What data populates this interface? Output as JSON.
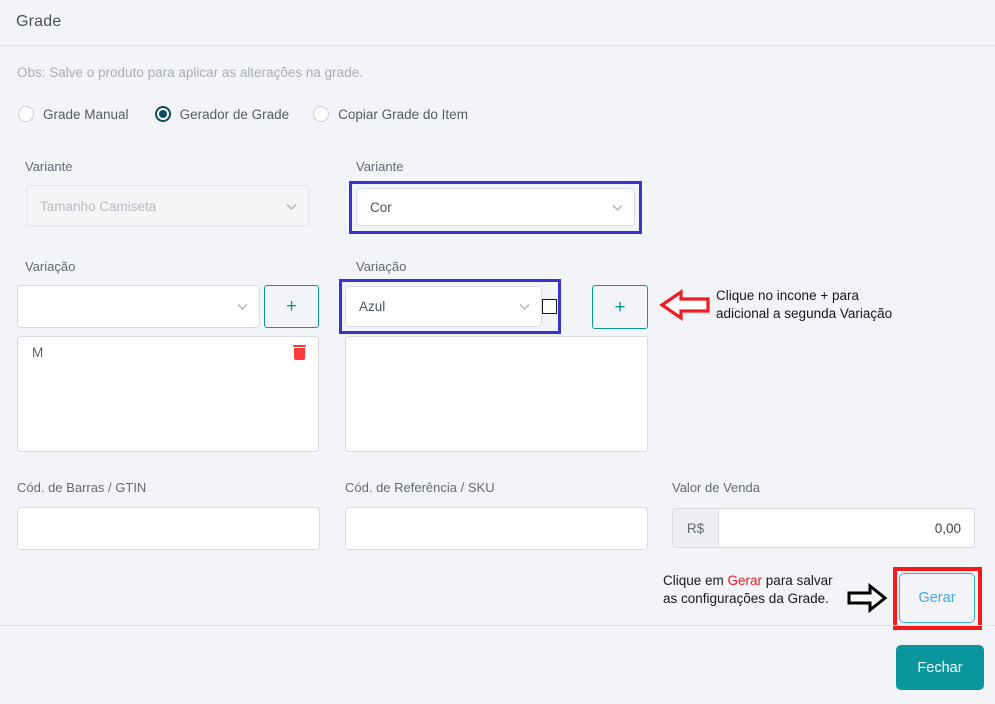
{
  "header": {
    "title": "Grade"
  },
  "body": {
    "obs": "Obs: Salve o produto para aplicar as alterações na grade.",
    "radios": [
      {
        "label": "Grade Manual",
        "selected": false
      },
      {
        "label": "Gerador de Grade",
        "selected": true
      },
      {
        "label": "Copiar Grade do Item",
        "selected": false
      }
    ],
    "variant_left": {
      "label": "Variante",
      "value": "Tamanho Camiseta",
      "disabled": true
    },
    "variant_right": {
      "label": "Variante",
      "value": "Cor",
      "highlighted": true
    },
    "variacao_left": {
      "label": "Variação",
      "value": "",
      "add_button": "+",
      "items": [
        {
          "label": "M",
          "delete_icon": "trash-icon"
        }
      ]
    },
    "variacao_right": {
      "label": "Variação",
      "value": "Azul",
      "checkbox_checked": false,
      "add_button": "+",
      "items": []
    },
    "barcode": {
      "label": "Cód. de Barras / GTIN",
      "value": ""
    },
    "sku": {
      "label": "Cód. de Referência / SKU",
      "value": ""
    },
    "price": {
      "label": "Valor de Venda",
      "prefix": "R$",
      "value": "0,00"
    }
  },
  "annotations": {
    "plus_hint_line1": "Clique no incone + para",
    "plus_hint_line2": "adicional a segunda Variação",
    "gerar_hint_prefix": "Clique em ",
    "gerar_hint_word": "Gerar",
    "gerar_hint_suffix": " para salvar",
    "gerar_hint_line2": "as configurações da Grade.",
    "arrow_left": "arrow-left-red",
    "arrow_right": "arrow-right-black"
  },
  "buttons": {
    "gerar": "Gerar",
    "fechar": "Fechar"
  },
  "colors": {
    "teal": "#0b959c",
    "accent_blue": "#3ea8f5",
    "highlight_blue": "#3b32cf",
    "highlight_red": "#f21a1a",
    "trash_red": "#fc3b3b",
    "page_bg": "#f2f4f8"
  }
}
